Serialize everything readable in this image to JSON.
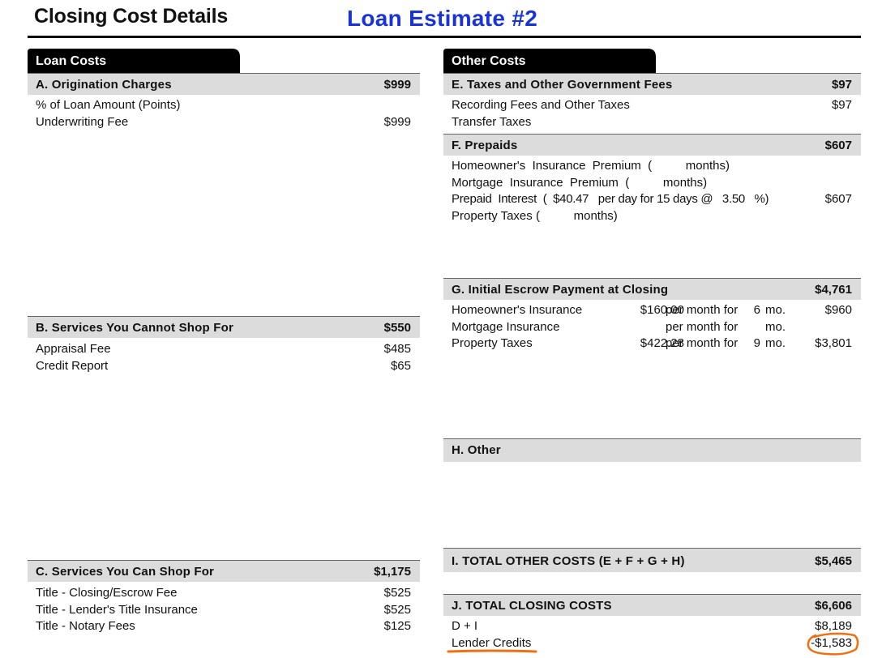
{
  "page": {
    "title": "Closing Cost Details",
    "subtitle": "Loan Estimate #2",
    "subtitle_color": "#1a33d9"
  },
  "colors": {
    "header_bg": "#dcdcdc",
    "tab_bg": "#000000",
    "annotation": "#f07010"
  },
  "loan_costs": {
    "tab": "Loan Costs",
    "a": {
      "label": "A.  Origination Charges",
      "total": "$999",
      "items": [
        {
          "label": "% of Loan Amount (Points)",
          "value": ""
        },
        {
          "label": "Underwriting Fee",
          "value": "$999"
        }
      ]
    },
    "b": {
      "label": "B.  Services You Cannot Shop For",
      "total": "$550",
      "items": [
        {
          "label": "Appraisal Fee",
          "value": "$485"
        },
        {
          "label": "Credit Report",
          "value": "$65"
        }
      ]
    },
    "c": {
      "label": "C.  Services You Can Shop For",
      "total": "$1,175",
      "items": [
        {
          "label": "Title - Closing/Escrow Fee",
          "value": "$525"
        },
        {
          "label": "Title - Lender's Title Insurance",
          "value": "$525"
        },
        {
          "label": "Title - Notary Fees",
          "value": "$125"
        }
      ]
    }
  },
  "other_costs": {
    "tab": "Other Costs",
    "e": {
      "label": "E.  Taxes and Other Government Fees",
      "total": "$97",
      "items": [
        {
          "label": "Recording Fees and Other Taxes",
          "value": "$97"
        },
        {
          "label": "Transfer Taxes",
          "value": ""
        }
      ]
    },
    "f": {
      "label": "F.  Prepaids",
      "total": "$607",
      "items": [
        {
          "label": "Homeowner's  Insurance  Premium  (          months)",
          "value": ""
        },
        {
          "label": "Mortgage  Insurance  Premium  (          months)",
          "value": ""
        },
        {
          "label": "Prepaid  Interest  (  $40.47   per day for 15 days @   3.50   %)",
          "value": "$607"
        },
        {
          "label": "Property Taxes (          months)",
          "value": ""
        }
      ]
    },
    "g": {
      "label": "G.  Initial Escrow Payment at Closing",
      "total": "$4,761",
      "items": [
        {
          "label": "Homeowner's Insurance",
          "amount": "$160.00",
          "per": "per month for",
          "months": "6",
          "mo": "mo.",
          "value": "$960"
        },
        {
          "label": "Mortgage Insurance",
          "amount": "",
          "per": "per month for",
          "months": "",
          "mo": "mo.",
          "value": ""
        },
        {
          "label": "Property Taxes",
          "amount": "$422.28",
          "per": "per month for",
          "months": "9",
          "mo": "mo.",
          "value": "$3,801"
        }
      ]
    },
    "h": {
      "label": "H.  Other",
      "total": ""
    },
    "i": {
      "label": "I.  TOTAL OTHER COSTS (E + F + G + H)",
      "total": "$5,465"
    },
    "j": {
      "label": "J.  TOTAL CLOSING COSTS",
      "total": "$6,606",
      "items": [
        {
          "label": "D + I",
          "value": "$8,189"
        },
        {
          "label": "Lender Credits",
          "value": "-$1,583"
        }
      ]
    }
  }
}
